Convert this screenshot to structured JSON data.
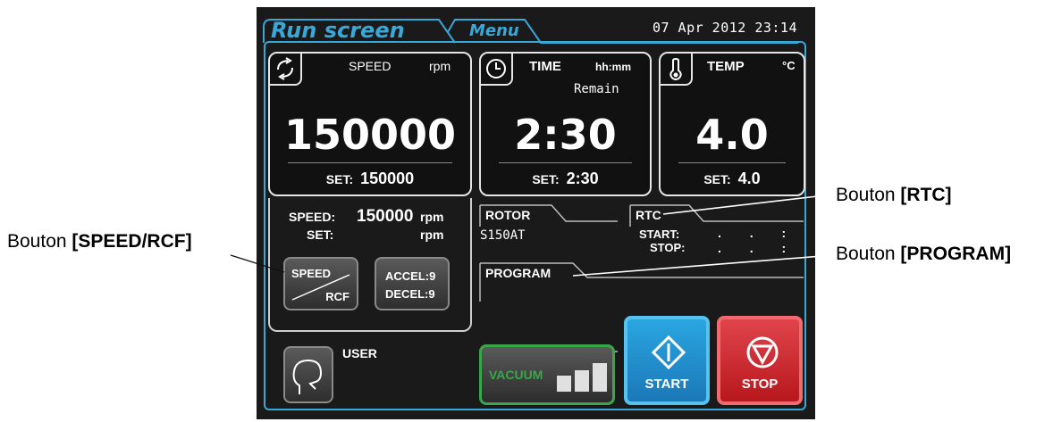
{
  "callouts": {
    "speed_rcf": {
      "prefix": "Bouton ",
      "name": "[SPEED/RCF]"
    },
    "rtc": {
      "prefix": "Bouton ",
      "name": "[RTC]"
    },
    "program": {
      "prefix": "Bouton ",
      "name": "[PROGRAM]"
    }
  },
  "tabs": {
    "run_screen": "Run screen",
    "menu": "Menu"
  },
  "datetime": "07 Apr 2012 23:14",
  "speed": {
    "label": "SPEED",
    "unit": "rpm",
    "value": "150000",
    "set_label": "SET:",
    "set_value": "150000"
  },
  "time": {
    "label": "TIME",
    "unit": "hh:mm",
    "mode": "Remain",
    "value": "2:30",
    "set_label": "SET:",
    "set_value": "2:30"
  },
  "temp": {
    "label": "TEMP",
    "unit": "°C",
    "value": "4.0",
    "set_label": "SET:",
    "set_value": "4.0"
  },
  "speed_info": {
    "speed_label": "SPEED:",
    "speed_value": "150000",
    "speed_unit": "rpm",
    "set_label": "SET:",
    "set_unit": "rpm"
  },
  "buttons": {
    "speed_rcf_top": "SPEED",
    "speed_rcf_bottom": "RCF",
    "accel": "ACCEL:9",
    "decel": "DECEL:9",
    "user": "USER",
    "vacuum": "VACUUM",
    "start": "START",
    "stop": "STOP"
  },
  "rotor": {
    "label": "ROTOR",
    "value": "S150AT"
  },
  "rtc": {
    "label": "RTC",
    "start_label": "START:",
    "stop_label": "STOP:",
    "start_value": ". . :",
    "stop_value": ". . :"
  },
  "program": {
    "label": "PROGRAM"
  },
  "colors": {
    "accent": "#39a8d8",
    "start": "#2aa6e0",
    "stop": "#d9282f",
    "vacuum": "#3aa64a"
  }
}
